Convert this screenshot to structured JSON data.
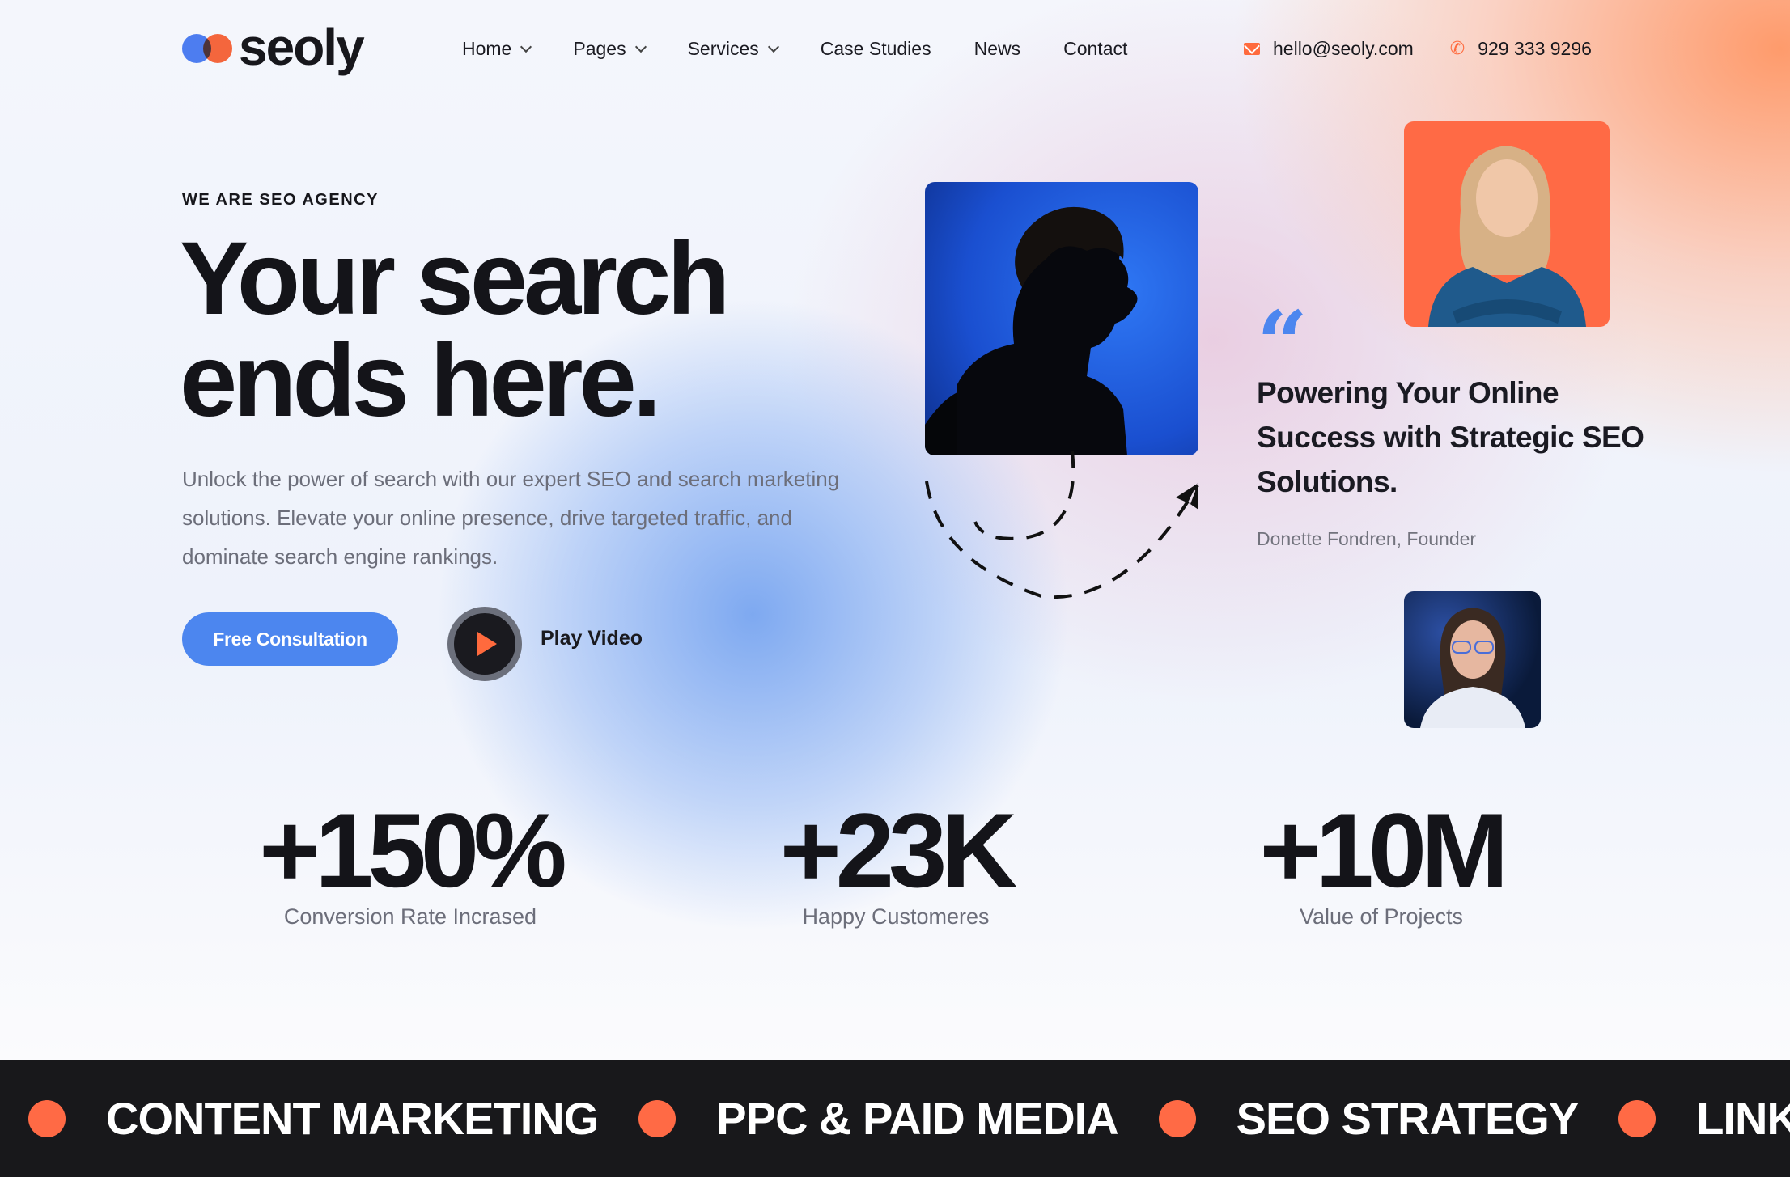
{
  "brand": {
    "name": "seoly"
  },
  "nav": {
    "items": [
      {
        "label": "Home",
        "has_dropdown": true
      },
      {
        "label": "Pages",
        "has_dropdown": true
      },
      {
        "label": "Services",
        "has_dropdown": true
      },
      {
        "label": "Case Studies",
        "has_dropdown": false
      },
      {
        "label": "News",
        "has_dropdown": false
      },
      {
        "label": "Contact",
        "has_dropdown": false
      }
    ]
  },
  "contact": {
    "email": "hello@seoly.com",
    "phone": "929 333 9296",
    "email_icon": "mail-icon",
    "phone_icon": "phone-icon"
  },
  "hero": {
    "eyebrow": "WE ARE SEO AGENCY",
    "headline_line1": "Your search",
    "headline_line2": "ends here.",
    "lead": "Unlock the power of search with our expert SEO and search marketing solutions. Elevate your online presence, drive targeted traffic, and dominate search engine rankings.",
    "primary_cta": "Free Consultation",
    "video_cta": "Play Video"
  },
  "testimonial": {
    "quote": "Powering Your Online Success with Strategic SEO Solutions.",
    "author": "Donette Fondren, Founder"
  },
  "stats": [
    {
      "value": "+150%",
      "label": "Conversion Rate Incrased"
    },
    {
      "value": "+23K",
      "label": "Happy Customeres"
    },
    {
      "value": "+10M",
      "label": "Value of Projects"
    }
  ],
  "ticker": {
    "items": [
      "CONTENT MARKETING",
      "PPC & PAID MEDIA",
      "SEO STRATEGY",
      "LINK B"
    ]
  },
  "colors": {
    "accent_blue": "#4c86ef",
    "accent_orange": "#ff6a45",
    "dark": "#18181b"
  }
}
